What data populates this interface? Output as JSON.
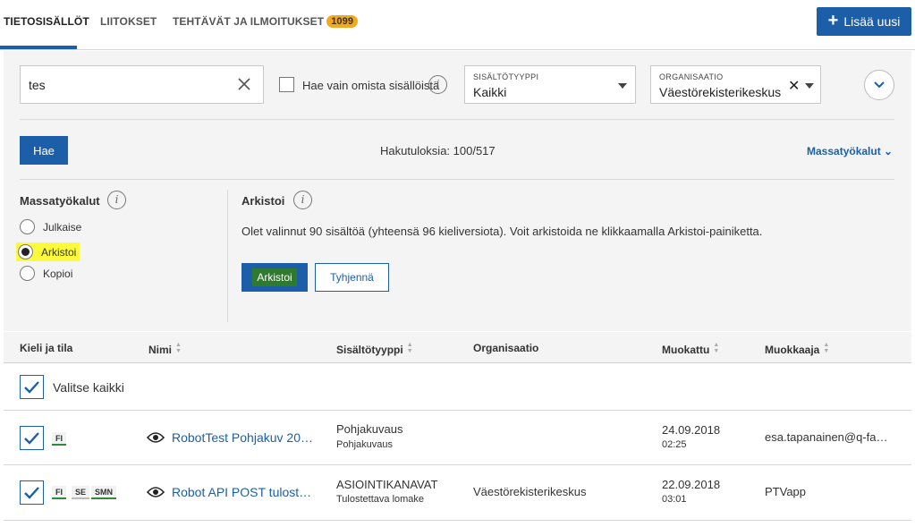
{
  "tabs": [
    {
      "label": "TIETOSISÄLLÖT",
      "active": true
    },
    {
      "label": "LIITOKSET"
    },
    {
      "label": "TEHTÄVÄT JA ILMOITUKSET",
      "badge": "1099"
    }
  ],
  "add_button": {
    "label": "Lisää uusi"
  },
  "filters": {
    "search_value": "tes",
    "own_only_label": "Hae vain omista sisällöistä",
    "content_type": {
      "label": "SISÄLTÖTYYPPI",
      "value": "Kaikki"
    },
    "organization": {
      "label": "ORGANISAATIO",
      "value": "Väestörekisterikeskus"
    }
  },
  "search_button": "Hae",
  "results_text": "Hakutuloksia: 100/517",
  "mass_tools_link": "Massatyökalut",
  "mass_tools": {
    "title": "Massatyökalut",
    "options": [
      "Julkaise",
      "Arkistoi",
      "Kopioi"
    ],
    "selected": "Arkistoi"
  },
  "archive": {
    "title": "Arkistoi",
    "description": "Olet valinnut  90 sisältöä (yhteensä 96 kieliversiota). Voit arkistoida ne klikkaamalla Arkistoi-painiketta.",
    "archive_button": "Arkistoi",
    "clear_button": "Tyhjennä"
  },
  "table": {
    "headers": [
      "Kieli ja tila",
      "Nimi",
      "Sisältötyyppi",
      "Organisaatio",
      "Muokattu",
      "Muokkaaja"
    ],
    "select_all": "Valitse kaikki",
    "rows": [
      {
        "langs": [
          "FI"
        ],
        "name": "RobotTest Pohjakuv 20…",
        "type": "Pohjakuvaus",
        "subtype": "Pohjakuvaus",
        "org": "",
        "date": "24.09.2018",
        "time": "02:25",
        "editor": "esa.tapanainen@q-fa…"
      },
      {
        "langs": [
          "FI",
          "SE",
          "SMN"
        ],
        "name": "Robot API POST tulost…",
        "type": "ASIOINTIKANAVAT",
        "subtype": "Tulostettava lomake",
        "org": "Väestörekisterikeskus",
        "date": "22.09.2018",
        "time": "03:01",
        "editor": "PTVapp"
      }
    ]
  },
  "colors": {
    "primary": "#1c5fa8",
    "badge": "#f3a821",
    "highlight": "#fbfb3c",
    "panel": "#f4f4f4"
  }
}
